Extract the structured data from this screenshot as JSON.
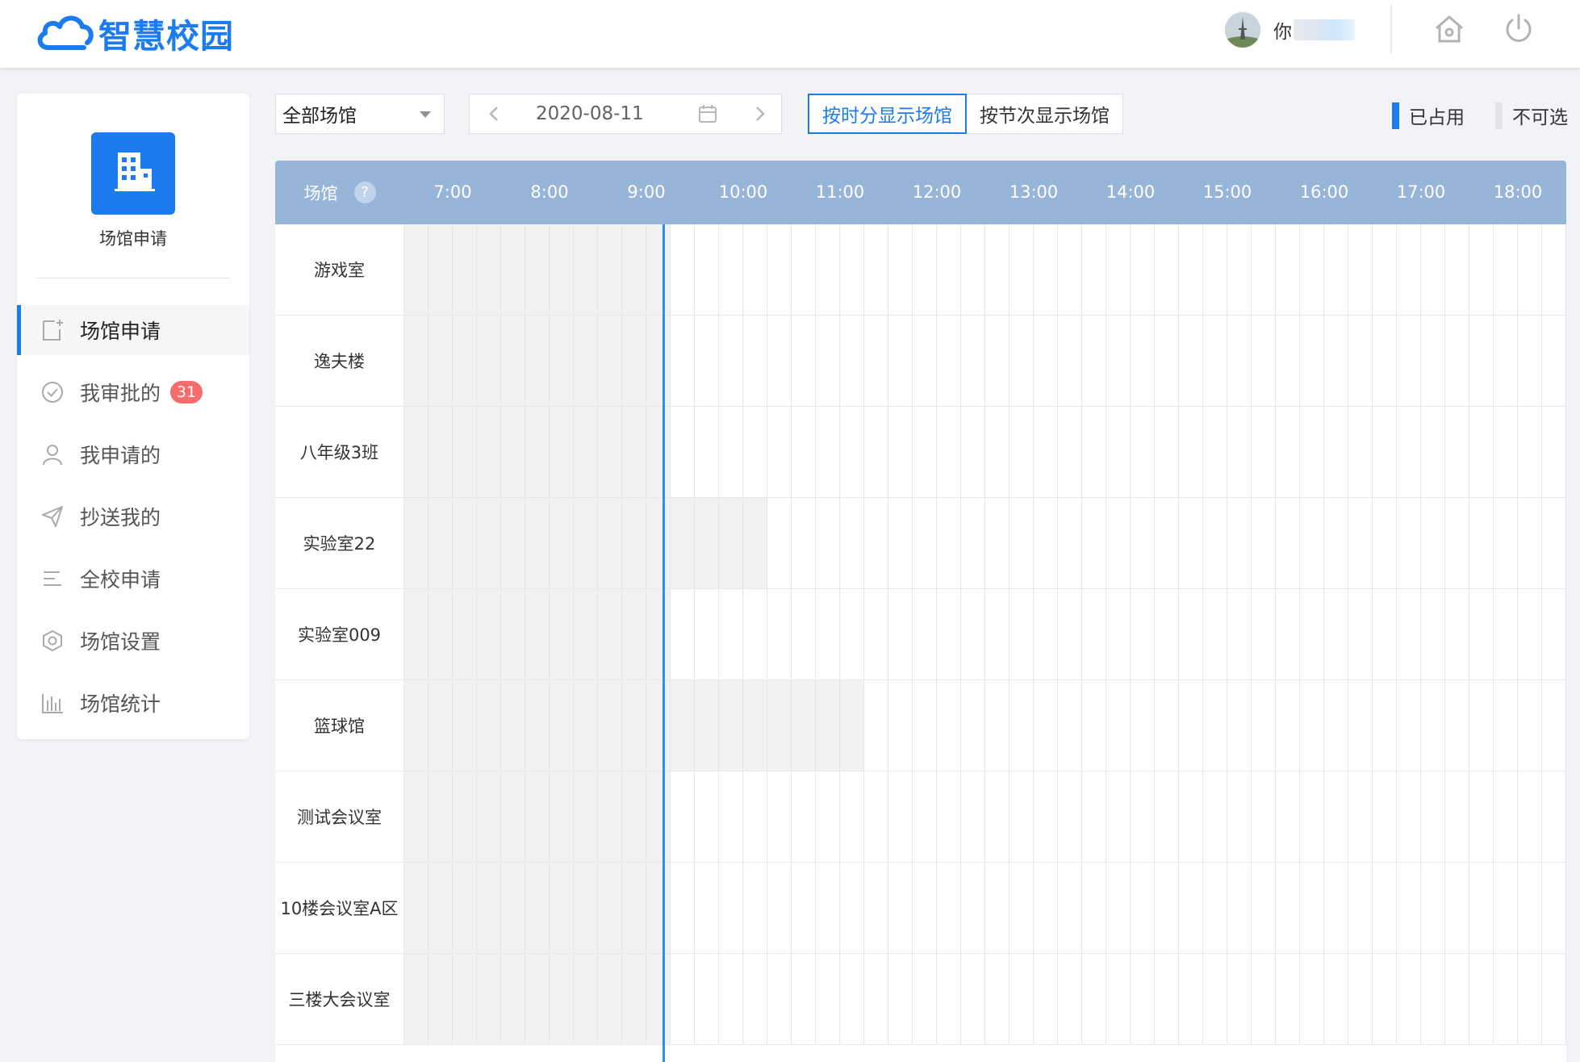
{
  "header": {
    "app_title": "智慧校园",
    "user_name": "你",
    "icons": [
      "cloud-logo-icon",
      "home-icon",
      "power-icon"
    ]
  },
  "colors": {
    "primary": "#1c7cef",
    "header_row": "#97b5d8",
    "unavailable": "#f2f2f2",
    "badge": "#f56c6c",
    "now_line": "#2f8df5"
  },
  "sidebar": {
    "app_tile_label": "场馆申请",
    "items": [
      {
        "label": "场馆申请",
        "icon": "apply-doc-icon",
        "active": true
      },
      {
        "label": "我审批的",
        "icon": "check-circle-icon",
        "badge": "31"
      },
      {
        "label": "我申请的",
        "icon": "user-icon"
      },
      {
        "label": "抄送我的",
        "icon": "send-icon"
      },
      {
        "label": "全校申请",
        "icon": "list-icon"
      },
      {
        "label": "场馆设置",
        "icon": "settings-hex-icon"
      },
      {
        "label": "场馆统计",
        "icon": "bar-chart-icon"
      }
    ]
  },
  "toolbar": {
    "venue_filter": "全部场馆",
    "date": "2020-08-11",
    "view_by_time": "按时分显示场馆",
    "view_by_period": "按节次显示场馆",
    "view_mode_active": "time"
  },
  "legend": [
    {
      "label": "已占用",
      "color": "#1c7cef"
    },
    {
      "label": "不可选",
      "color": "#e3e3e3"
    }
  ],
  "schedule": {
    "venue_header": "场馆",
    "help_mark": "?",
    "hours": [
      "7:00",
      "8:00",
      "9:00",
      "10:00",
      "11:00",
      "12:00",
      "13:00",
      "14:00",
      "15:00",
      "16:00",
      "17:00",
      "18:00"
    ],
    "current_time": "9:10",
    "venues": [
      {
        "name": "游戏室"
      },
      {
        "name": "逸夫楼"
      },
      {
        "name": "八年级3班"
      },
      {
        "name": "实验室22",
        "unavailable": [
          "9:10",
          "10:10"
        ]
      },
      {
        "name": "实验室009"
      },
      {
        "name": "篮球馆",
        "unavailable": [
          "9:10",
          "11:10"
        ]
      },
      {
        "name": "测试会议室"
      },
      {
        "name": "10楼会议室A区"
      },
      {
        "name": "三楼大会议室"
      }
    ]
  }
}
